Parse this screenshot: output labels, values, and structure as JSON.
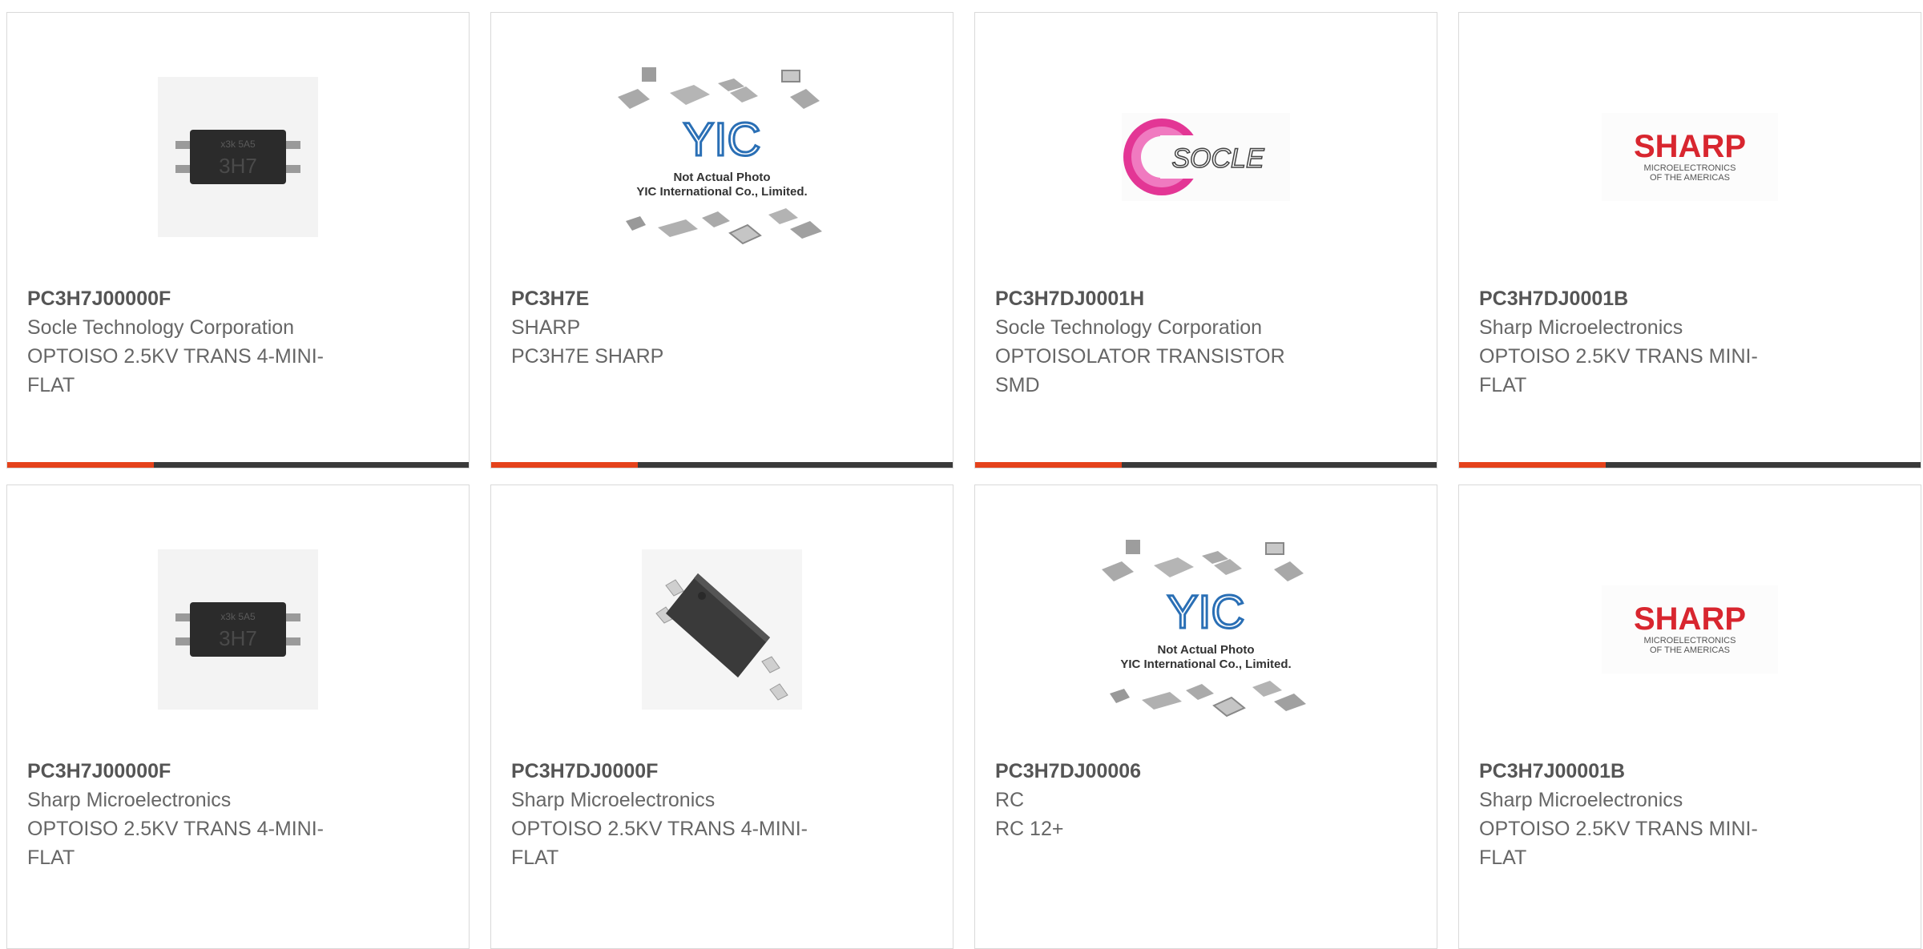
{
  "colors": {
    "accent": "#e5421b",
    "bar": "#3a3a3a",
    "border": "#d9d9d9",
    "text": "#666666",
    "socle_pink": "#e0208a",
    "sharp_red": "#d8262f",
    "yic_blue": "#2a6fb5"
  },
  "logos": {
    "yic_letters": "YIC",
    "yic_line1": "Not Actual Photo",
    "yic_line2": "YIC International Co., Limited.",
    "socle_text": "SOCLE",
    "sharp_name": "SHARP",
    "sharp_line1": "MICROELECTRONICS",
    "sharp_line2": "OF THE AMERICAS",
    "chip_marking_top": "x3k 5A5",
    "chip_marking_main": "3H7"
  },
  "products": [
    {
      "part": "PC3H7J00000F",
      "manufacturer": "Socle Technology Corporation",
      "description_line1": "OPTOISO 2.5KV TRANS 4-MINI-",
      "description_line2": "FLAT",
      "image_icon": "chip-smd-photo"
    },
    {
      "part": "PC3H7E",
      "manufacturer": "SHARP",
      "description_line1": "PC3H7E SHARP",
      "description_line2": "",
      "image_icon": "yic-placeholder-image"
    },
    {
      "part": "PC3H7DJ0001H",
      "manufacturer": "Socle Technology Corporation",
      "description_line1": "OPTOISOLATOR TRANSISTOR",
      "description_line2": "SMD",
      "image_icon": "socle-logo"
    },
    {
      "part": "PC3H7DJ0001B",
      "manufacturer": "Sharp Microelectronics",
      "description_line1": "OPTOISO 2.5KV TRANS MINI-",
      "description_line2": "FLAT",
      "image_icon": "sharp-logo"
    },
    {
      "part": "PC3H7J00000F",
      "manufacturer": "Sharp Microelectronics",
      "description_line1": "OPTOISO 2.5KV TRANS 4-MINI-",
      "description_line2": "FLAT",
      "image_icon": "chip-smd-photo"
    },
    {
      "part": "PC3H7DJ0000F",
      "manufacturer": "Sharp Microelectronics",
      "description_line1": "OPTOISO 2.5KV TRANS 4-MINI-",
      "description_line2": "FLAT",
      "image_icon": "chip-angled-photo"
    },
    {
      "part": "PC3H7DJ00006",
      "manufacturer": "RC",
      "description_line1": "RC 12+",
      "description_line2": "",
      "image_icon": "yic-placeholder-image"
    },
    {
      "part": "PC3H7J00001B",
      "manufacturer": "Sharp Microelectronics",
      "description_line1": "OPTOISO 2.5KV TRANS MINI-",
      "description_line2": "FLAT",
      "image_icon": "sharp-logo"
    }
  ]
}
